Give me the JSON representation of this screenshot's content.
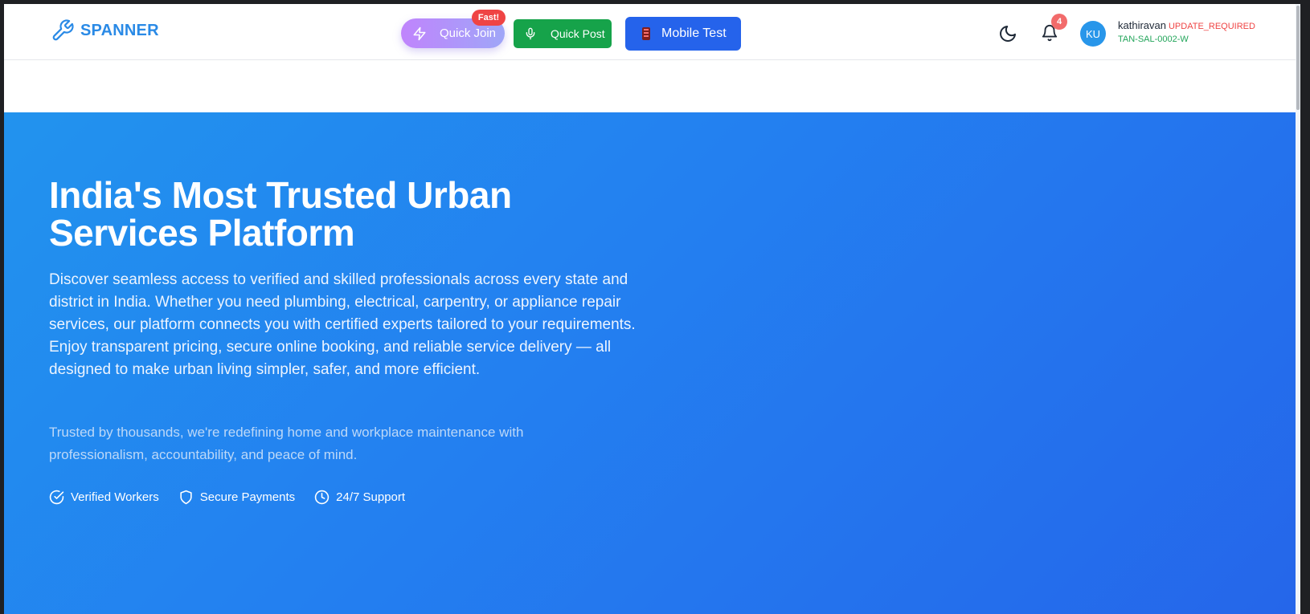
{
  "header": {
    "logo_text": "SPANNER",
    "logo_icon": "wrench-icon",
    "quick_join": {
      "label": "Quick Join",
      "badge": "Fast!",
      "icon": "zap-icon"
    },
    "quick_post": {
      "label": "Quick Post",
      "icon": "microphone-icon"
    },
    "mobile_test": {
      "label": "Mobile Test",
      "icon": "mobile-phone-icon"
    },
    "theme_icon": "moon-icon",
    "notifications": {
      "icon": "bell-icon",
      "count": "4"
    },
    "user": {
      "initials": "KU",
      "name": "kathiravan",
      "status": "UPDATE_REQUIRED",
      "id": "TAN-SAL-0002-W"
    }
  },
  "hero": {
    "title": "India's Most Trusted Urban Services Platform",
    "description": "Discover seamless access to verified and skilled professionals across every state and district in India. Whether you need plumbing, electrical, carpentry, or appliance repair services, our platform connects you with certified experts tailored to your requirements. Enjoy transparent pricing, secure online booking, and reliable service delivery — all designed to make urban living simpler, safer, and more efficient.",
    "subtext": "Trusted by thousands, we're redefining home and workplace maintenance with professionalism, accountability, and peace of mind.",
    "features": [
      {
        "label": "Verified Workers",
        "icon": "check-circle-icon"
      },
      {
        "label": "Secure Payments",
        "icon": "shield-icon"
      },
      {
        "label": "24/7 Support",
        "icon": "clock-icon"
      }
    ]
  },
  "colors": {
    "brand": "#2a8ae6",
    "hero_start": "#2293ee",
    "hero_end": "#2566ea",
    "quick_post": "#16a34a",
    "mobile_test": "#2563eb",
    "badge": "#ef4444",
    "status_warning": "#ef4444",
    "status_id": "#22a55a"
  }
}
